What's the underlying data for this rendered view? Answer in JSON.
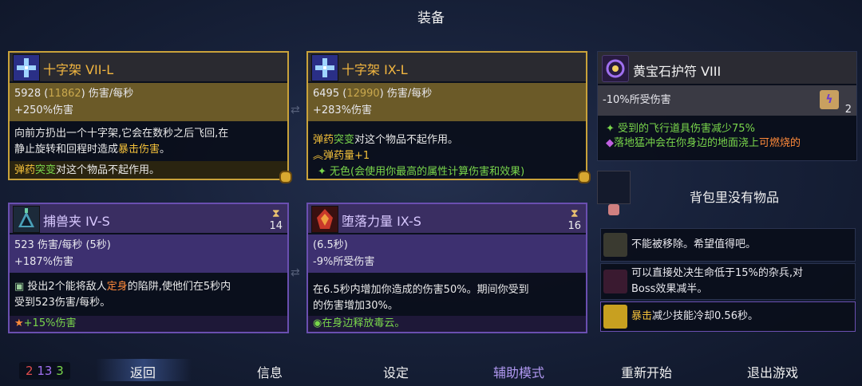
{
  "title": "装备",
  "weapons": [
    {
      "name": "十字架 VII-L",
      "dps": "5928",
      "dps_alt": "11862",
      "dps_unit": "伤害/每秒",
      "bonus": "+250%伤害",
      "desc_1": "向前方扔出一个十字架,它会在数秒之后飞回,在",
      "desc_2a": "静止旋转和回程时造成",
      "desc_2b": "暴击伤害",
      "desc_2c": "。",
      "mutation_a": "弹药",
      "mutation_b": "突变",
      "mutation_c": "对这个物品不起作用。"
    },
    {
      "name": "十字架 IX-L",
      "dps": "6495",
      "dps_alt": "12990",
      "dps_unit": "伤害/每秒",
      "bonus": "+283%伤害",
      "mutation_a": "弹药",
      "mutation_b": "突变",
      "mutation_c": "对这个物品不起作用。",
      "ammo_line": "弹药量+1",
      "ammo_icon": "ammo-icon",
      "colorless_line": "无色(会使用你最高的属性计算伤害和效果)"
    }
  ],
  "skills": [
    {
      "name": "捕兽夹 IV-S",
      "count": "14",
      "line1": "523 伤害/每秒 (5秒)",
      "line2": "+187%伤害",
      "desc_1a": "投出2个能将敌人",
      "desc_1b": "定身",
      "desc_1c": "的陷阱,使他们在5秒内",
      "desc_2": "受到523伤害/每秒。",
      "bonus": "+15%伤害"
    },
    {
      "name": "堕落力量 IX-S",
      "count": "16",
      "line1": "(6.5秒)",
      "line2": "-9%所受伤害",
      "desc_1": "在6.5秒内增加你造成的伤害50%。期间你受到",
      "desc_2": "的伤害增加30%。",
      "bonus": "在身边释放毒云。"
    }
  ],
  "amulet": {
    "name": "黄宝石护符 VIII",
    "stat": "-10%所受伤害",
    "scroll_count": "2",
    "line1": "受到的飞行道具伤害减少75%",
    "line2a": "落地猛冲会在你身边的地面浇上",
    "line2b": "可燃烧的"
  },
  "backpack": {
    "label": "背包里没有物品"
  },
  "passives": [
    {
      "text": "不能被移除。希望值得吧。"
    },
    {
      "text_1": "可以直接处决生命低于15%的杂兵,对",
      "text_2": "Boss效果减半。"
    },
    {
      "text_a": "暴击",
      "text_b": "减少技能冷却0.56秒。"
    }
  ],
  "footer": {
    "stat_red": "2",
    "stat_purple": "13",
    "stat_green": "3",
    "back": "返回",
    "info": "信息",
    "settings": "设定",
    "assist": "辅助模式",
    "restart": "重新开始",
    "quit": "退出游戏"
  },
  "colors": {
    "gold_border": "#c9a23a",
    "purple_border": "#6a4fb0",
    "brutality_red": "#e04b4b",
    "tactics_purple": "#a070f0",
    "survival_green": "#79d64b"
  }
}
